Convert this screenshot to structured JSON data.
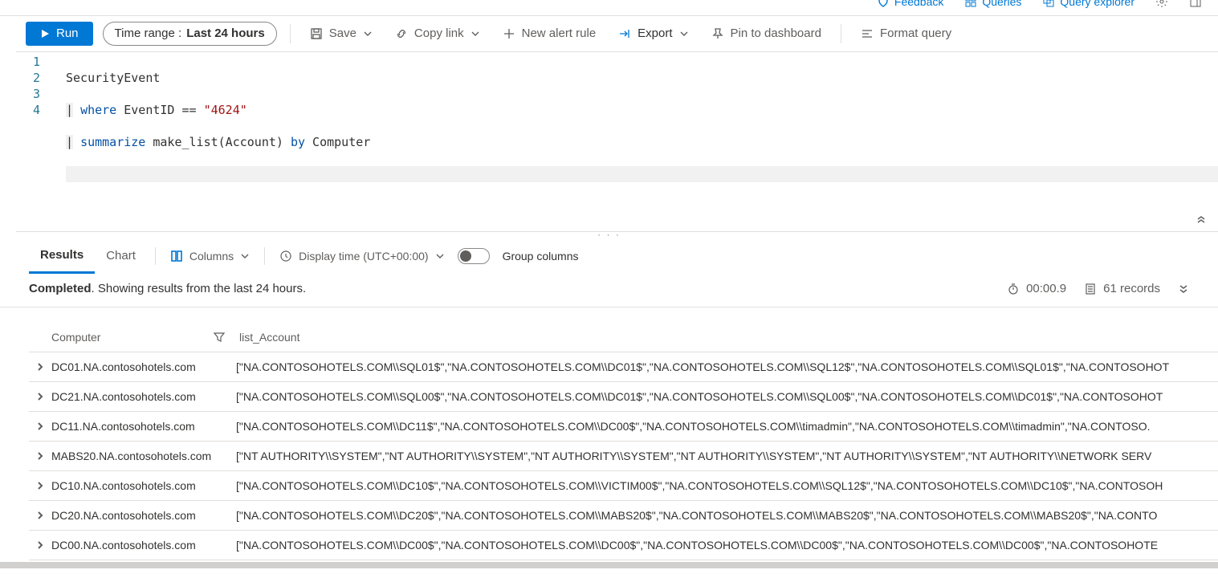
{
  "topbar": {
    "feedback": "Feedback",
    "queries": "Queries",
    "explorer": "Query explorer"
  },
  "toolbar": {
    "run": "Run",
    "timerange_label": "Time range :",
    "timerange_value": "Last 24 hours",
    "save": "Save",
    "copy_link": "Copy link",
    "new_alert": "New alert rule",
    "export": "Export",
    "pin": "Pin to dashboard",
    "format": "Format query"
  },
  "editor": {
    "line_numbers": [
      "1",
      "2",
      "3",
      "4"
    ],
    "line1_text": "SecurityEvent",
    "line2_pipe": "|",
    "line2_kw": "where",
    "line2_mid": " EventID == ",
    "line2_str": "\"4624\"",
    "line3_pipe": "|",
    "line3_kw": "summarize",
    "line3_mid": " make_list(Account) ",
    "line3_by": "by",
    "line3_end": " Computer",
    "drag": "· · ·"
  },
  "results_tabs": {
    "results": "Results",
    "chart": "Chart",
    "columns": "Columns",
    "display_time": "Display time (UTC+00:00)",
    "group_columns": "Group columns"
  },
  "status": {
    "completed_bold": "Completed",
    "completed_rest": ". Showing results from the last 24 hours.",
    "duration": "00:00.9",
    "records": "61 records"
  },
  "grid": {
    "header_computer": "Computer",
    "header_list": "list_Account",
    "rows": [
      {
        "computer": "DC01.NA.contosohotels.com",
        "list": "[\"NA.CONTOSOHOTELS.COM\\\\SQL01$\",\"NA.CONTOSOHOTELS.COM\\\\DC01$\",\"NA.CONTOSOHOTELS.COM\\\\SQL12$\",\"NA.CONTOSOHOTELS.COM\\\\SQL01$\",\"NA.CONTOSOHOT"
      },
      {
        "computer": "DC21.NA.contosohotels.com",
        "list": "[\"NA.CONTOSOHOTELS.COM\\\\SQL00$\",\"NA.CONTOSOHOTELS.COM\\\\DC01$\",\"NA.CONTOSOHOTELS.COM\\\\SQL00$\",\"NA.CONTOSOHOTELS.COM\\\\DC01$\",\"NA.CONTOSOHOT"
      },
      {
        "computer": "DC11.NA.contosohotels.com",
        "list": "[\"NA.CONTOSOHOTELS.COM\\\\DC11$\",\"NA.CONTOSOHOTELS.COM\\\\DC00$\",\"NA.CONTOSOHOTELS.COM\\\\timadmin\",\"NA.CONTOSOHOTELS.COM\\\\timadmin\",\"NA.CONTOSO."
      },
      {
        "computer": "MABS20.NA.contosohotels.com",
        "list": "[\"NT AUTHORITY\\\\SYSTEM\",\"NT AUTHORITY\\\\SYSTEM\",\"NT AUTHORITY\\\\SYSTEM\",\"NT AUTHORITY\\\\SYSTEM\",\"NT AUTHORITY\\\\SYSTEM\",\"NT AUTHORITY\\\\NETWORK SERV"
      },
      {
        "computer": "DC10.NA.contosohotels.com",
        "list": "[\"NA.CONTOSOHOTELS.COM\\\\DC10$\",\"NA.CONTOSOHOTELS.COM\\\\VICTIM00$\",\"NA.CONTOSOHOTELS.COM\\\\SQL12$\",\"NA.CONTOSOHOTELS.COM\\\\DC10$\",\"NA.CONTOSOH"
      },
      {
        "computer": "DC20.NA.contosohotels.com",
        "list": "[\"NA.CONTOSOHOTELS.COM\\\\DC20$\",\"NA.CONTOSOHOTELS.COM\\\\MABS20$\",\"NA.CONTOSOHOTELS.COM\\\\MABS20$\",\"NA.CONTOSOHOTELS.COM\\\\MABS20$\",\"NA.CONTO"
      },
      {
        "computer": "DC00.NA.contosohotels.com",
        "list": "[\"NA.CONTOSOHOTELS.COM\\\\DC00$\",\"NA.CONTOSOHOTELS.COM\\\\DC00$\",\"NA.CONTOSOHOTELS.COM\\\\DC00$\",\"NA.CONTOSOHOTELS.COM\\\\DC00$\",\"NA.CONTOSOHOTE"
      }
    ]
  }
}
